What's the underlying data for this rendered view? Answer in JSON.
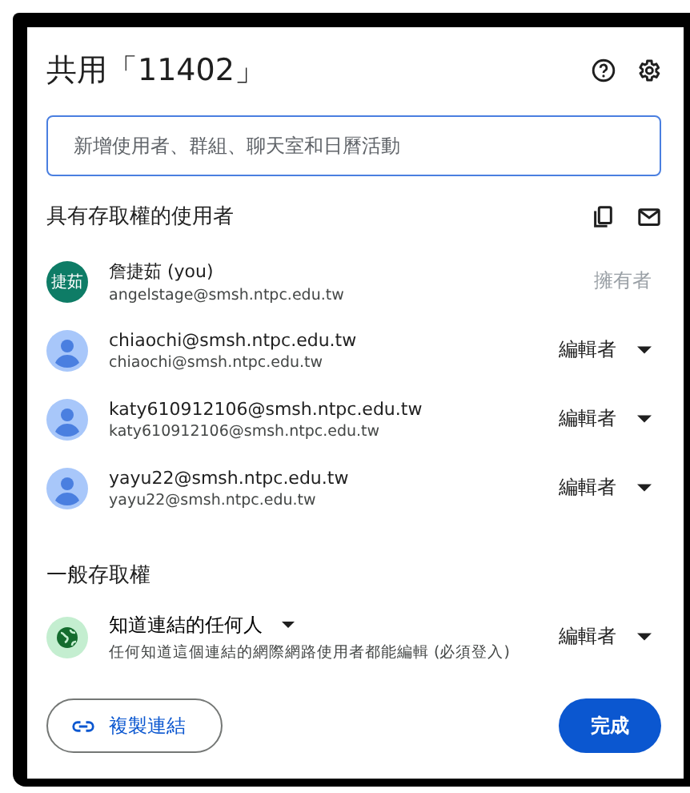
{
  "dialog": {
    "title": "共用「11402」"
  },
  "search": {
    "placeholder": "新增使用者、群組、聊天室和日曆活動"
  },
  "people_section": {
    "heading": "具有存取權的使用者"
  },
  "people": [
    {
      "kind": "initials",
      "initials": "捷茹",
      "name": "詹捷茹 (you)",
      "email": "angelstage@smsh.ntpc.edu.tw",
      "role": "擁有者",
      "role_editable": false
    },
    {
      "kind": "default",
      "name": "chiaochi@smsh.ntpc.edu.tw",
      "email": "chiaochi@smsh.ntpc.edu.tw",
      "role": "編輯者",
      "role_editable": true
    },
    {
      "kind": "default",
      "name": "katy610912106@smsh.ntpc.edu.tw",
      "email": "katy610912106@smsh.ntpc.edu.tw",
      "role": "編輯者",
      "role_editable": true
    },
    {
      "kind": "default",
      "name": "yayu22@smsh.ntpc.edu.tw",
      "email": "yayu22@smsh.ntpc.edu.tw",
      "role": "編輯者",
      "role_editable": true
    }
  ],
  "general_access": {
    "heading": "一般存取權",
    "option": "知道連結的任何人",
    "description": "任何知道這個連結的網際網路使用者都能編輯 (必須登入)",
    "role": "編輯者"
  },
  "buttons": {
    "copy_link": "複製連結",
    "done": "完成"
  }
}
